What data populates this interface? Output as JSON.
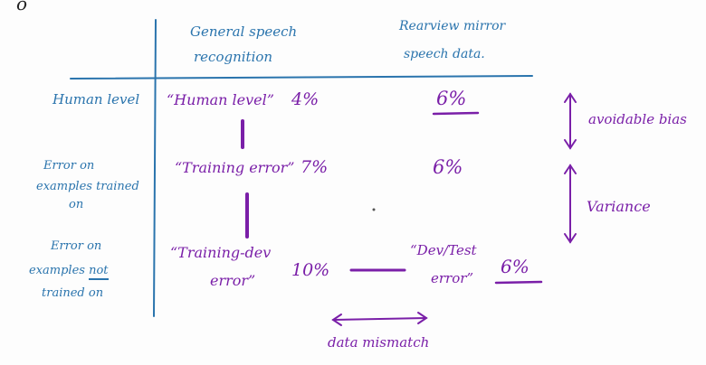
{
  "colors": {
    "background": "#fdfdfd",
    "blue_ink": "#2a74ad",
    "purple_ink": "#7a1fa8",
    "black_ink": "#222222"
  },
  "top_fragment": "o",
  "columns": {
    "col1_line1": "General speech",
    "col1_line2": "recognition",
    "col2_line1": "Rearview mirror",
    "col2_line2": "speech data."
  },
  "rows": {
    "row1_label": "Human level",
    "row2_label_line1": "Error on",
    "row2_label_line2": "examples trained",
    "row2_label_line3": "on",
    "row3_label_line1": "Error on",
    "row3_label_line2_prefix": "examples",
    "row3_label_line2_emph": "not",
    "row3_label_line3": "trained on"
  },
  "cells": {
    "human_level_label": "“Human level”",
    "human_level_value": "4%",
    "training_error_label": "“Training error”",
    "training_error_value": "7%",
    "training_dev_line1": "“Training-dev",
    "training_dev_line2": "error”",
    "training_dev_value": "10%",
    "rear_human": "6%",
    "rear_training": "6%",
    "dev_test_line1": "“Dev/Test",
    "dev_test_line2": "error”",
    "dev_test_value": "6%"
  },
  "annotations": {
    "avoidable_bias": "avoidable bias",
    "variance": "Variance",
    "data_mismatch": "data mismatch"
  }
}
